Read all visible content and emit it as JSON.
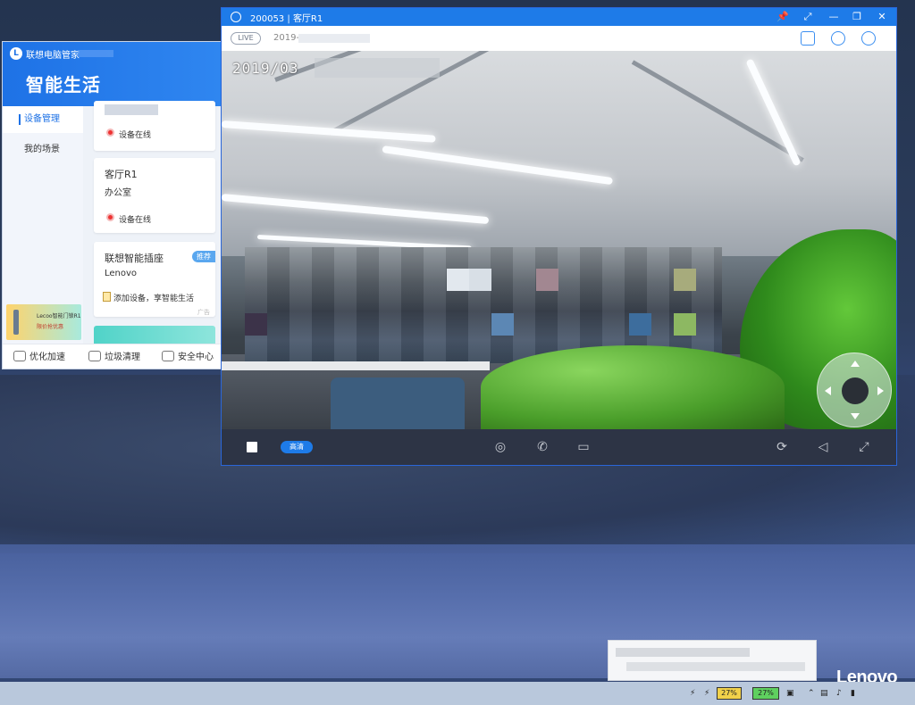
{
  "manager": {
    "app_name": "联想电脑管家",
    "title": "智能生活",
    "side_items": [
      "设备管理",
      "我的场景"
    ],
    "cards": [
      {
        "status": "设备在线"
      },
      {
        "name": "客厅R1",
        "location": "办公室",
        "status": "设备在线"
      },
      {
        "name": "联想智能插座",
        "brand": "Lenovo",
        "badge": "推荐",
        "add_text": "添加设备，享智能生活",
        "ad_tag": "广告"
      }
    ],
    "banner": {
      "line1": "Lecoo智能门锁R1",
      "line2": "限价抢优惠"
    },
    "bottom_items": [
      "优化加速",
      "垃圾清理",
      "安全中心"
    ]
  },
  "camera": {
    "title_id": "200053",
    "title_sep": "|",
    "title_name": "客厅R1",
    "live_label": "LIVE",
    "date_label": "2019-",
    "osd_date": "2019/03",
    "hd_label": "高清",
    "window_buttons": [
      "📌",
      "⤢",
      "—",
      "❐",
      "✕"
    ],
    "info_icons": [
      "folder-icon",
      "cloud-video-icon",
      "settings-icon"
    ],
    "controls": [
      "camera-icon",
      "phone-icon",
      "video-icon"
    ],
    "right_controls": [
      "rotate-icon",
      "mute-icon",
      "fullscreen-icon"
    ]
  },
  "taskbar": {
    "battery1": "27%",
    "battery2": "27%",
    "brand": "Lenovo"
  }
}
